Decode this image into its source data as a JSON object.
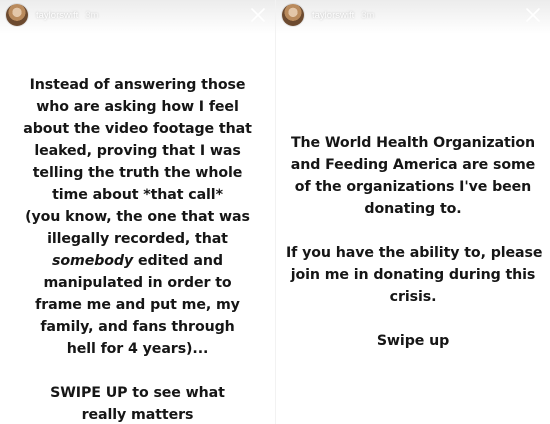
{
  "stories": [
    {
      "username": "taylorswift",
      "time": "3m",
      "close_icon": "close-x-icon",
      "paragraphs": [
        [
          "Instead of answering those",
          "who are asking how I feel",
          "about the video footage that",
          "leaked, proving that I was",
          "telling the truth the whole",
          "time about *that call*",
          "(you know, the one that was",
          "illegally recorded, that",
          [
            "somebody",
            " edited and"
          ],
          "manipulated in order to",
          "frame me and put me, my",
          "family, and fans through",
          "hell for 4 years)..."
        ],
        [
          "SWIPE UP to see what",
          "really matters"
        ]
      ]
    },
    {
      "username": "taylorswift",
      "time": "3m",
      "close_icon": "close-x-icon",
      "paragraphs": [
        [
          "The World Health Organization",
          "and Feeding America are some",
          "of the organizations I've been",
          "donating to."
        ],
        [
          "If you have the ability to, please",
          "join me in donating during this",
          "crisis."
        ],
        [
          "Swipe up"
        ]
      ]
    }
  ]
}
